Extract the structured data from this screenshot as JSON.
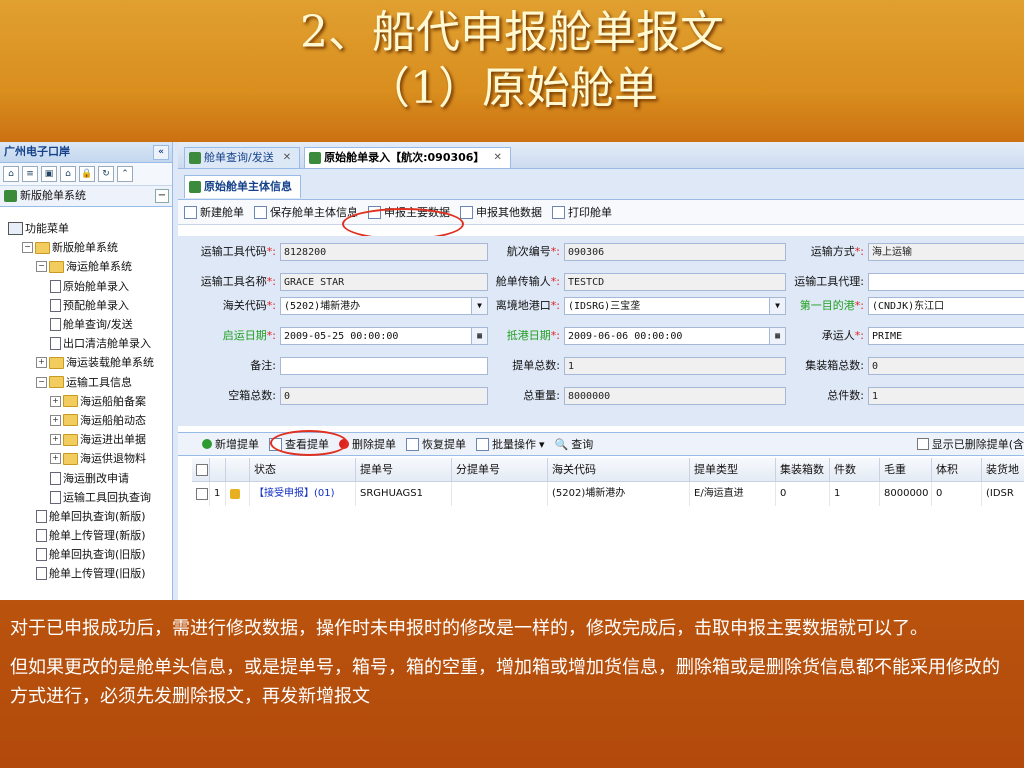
{
  "slide": {
    "title_line1": "2、船代申报舱单报文",
    "title_line2": "（1）原始舱单",
    "paragraph1": "对于已申报成功后，需进行修改数据，操作时未申报时的修改是一样的，修改完成后，击取申报主要数据就可以了。",
    "paragraph2": "但如果更改的是舱单头信息，或是提单号，箱号，箱的空重，增加箱或增加货信息，删除箱或是删除货信息都不能采用修改的方式进行，必须先发删除报文，再发新增报文"
  },
  "left_panel": {
    "title": "广州电子口岸",
    "collapse": "«",
    "icons": [
      "home-icon",
      "list-icon",
      "save-icon",
      "house-icon",
      "lock-icon",
      "refresh-icon",
      "up-icon"
    ],
    "system": "新版舱单系统",
    "tree": [
      {
        "label": "功能菜单",
        "level": 0,
        "kind": "root"
      },
      {
        "label": "新版舱单系统",
        "level": 1,
        "kind": "folder",
        "exp": "−"
      },
      {
        "label": "海运舱单系统",
        "level": 2,
        "kind": "folder",
        "exp": "−"
      },
      {
        "label": "原始舱单录入",
        "level": 3,
        "kind": "doc"
      },
      {
        "label": "预配舱单录入",
        "level": 3,
        "kind": "doc"
      },
      {
        "label": "舱单查询/发送",
        "level": 3,
        "kind": "doc"
      },
      {
        "label": "出口清洁舱单录入",
        "level": 3,
        "kind": "doc"
      },
      {
        "label": "海运装载舱单系统",
        "level": 2,
        "kind": "folder",
        "exp": "+"
      },
      {
        "label": "运输工具信息",
        "level": 2,
        "kind": "folder",
        "exp": "−"
      },
      {
        "label": "海运船舶备案",
        "level": 3,
        "kind": "folder",
        "exp": "+"
      },
      {
        "label": "海运船舶动态",
        "level": 3,
        "kind": "folder",
        "exp": "+"
      },
      {
        "label": "海运进出单据",
        "level": 3,
        "kind": "folder",
        "exp": "+"
      },
      {
        "label": "海运供退物料",
        "level": 3,
        "kind": "folder",
        "exp": "+"
      },
      {
        "label": "海运删改申请",
        "level": 3,
        "kind": "doc"
      },
      {
        "label": "运输工具回执查询",
        "level": 3,
        "kind": "doc"
      },
      {
        "label": "舱单回执查询(新版)",
        "level": 2,
        "kind": "doc"
      },
      {
        "label": "舱单上传管理(新版)",
        "level": 2,
        "kind": "doc"
      },
      {
        "label": "舱单回执查询(旧版)",
        "level": 2,
        "kind": "doc"
      },
      {
        "label": "舱单上传管理(旧版)",
        "level": 2,
        "kind": "doc"
      }
    ]
  },
  "tabs": [
    {
      "label": "舱单查询/发送",
      "close": "✕"
    },
    {
      "label": "原始舱单录入【航次:090306】",
      "close": "✕"
    }
  ],
  "subtab": "原始舱单主体信息",
  "toolbar": [
    "新建舱单",
    "保存舱单主体信息",
    "申报主要数据",
    "申报其他数据",
    "打印舱单"
  ],
  "form": {
    "transport_code": {
      "label": "运输工具代码",
      "value": "8128200"
    },
    "voyage_no": {
      "label": "航次编号",
      "value": "090306"
    },
    "transport_mode": {
      "label": "运输方式",
      "value": "海上运输"
    },
    "transport_name": {
      "label": "运输工具名称",
      "value": "GRACE STAR"
    },
    "manifest_sender": {
      "label": "舱单传输人",
      "value": "TESTCD"
    },
    "transport_agent": {
      "label": "运输工具代理",
      "value": ""
    },
    "customs_code": {
      "label": "海关代码",
      "value": "(5202)埔新港办"
    },
    "departure_port": {
      "label": "离境地港口",
      "value": "(IDSRG)三宝垄"
    },
    "first_port": {
      "label": "第一目的港",
      "value": "(CNDJK)东江口"
    },
    "departure_date": {
      "label": "启运日期",
      "value": "2009-05-25 00:00:00"
    },
    "arrival_date": {
      "label": "抵港日期",
      "value": "2009-06-06 00:00:00"
    },
    "carrier": {
      "label": "承运人",
      "value": "PRIME"
    },
    "remark": {
      "label": "备注",
      "value": ""
    },
    "bill_total": {
      "label": "提单总数",
      "value": "1"
    },
    "container_total": {
      "label": "集装箱总数",
      "value": "0"
    },
    "empty_total": {
      "label": "空箱总数",
      "value": "0"
    },
    "gross_weight": {
      "label": "总重量",
      "value": "8000000"
    },
    "piece_total": {
      "label": "总件数",
      "value": "1"
    },
    "required_mark": "*:",
    "colon": ":"
  },
  "grid_toolbar": [
    "新增提单",
    "查看提单",
    "删除提单",
    "恢复提单",
    "批量操作",
    "查询"
  ],
  "grid_toolbar_right": "显示已删除提单(含",
  "grid": {
    "headers": [
      "",
      "",
      "",
      "状态",
      "提单号",
      "分提单号",
      "海关代码",
      "提单类型",
      "集装箱数",
      "件数",
      "毛重",
      "体积",
      "装货地"
    ],
    "rows": [
      [
        "",
        "1",
        "",
        "【接受申报】(01)",
        "SRGHUAGS1",
        "",
        "(5202)埔新港办",
        "E/海运直进",
        "0",
        "1",
        "8000000",
        "0",
        "(IDSR"
      ]
    ]
  }
}
